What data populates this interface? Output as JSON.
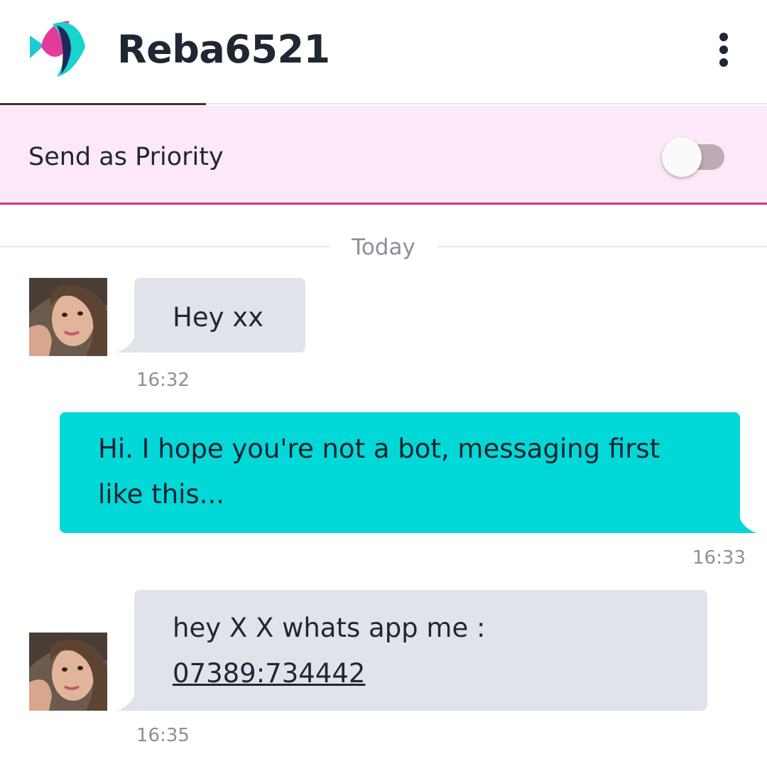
{
  "header": {
    "logo_icon": "fish-logo-icon",
    "contact_name": "Reba6521",
    "menu_icon": "more-vertical-icon"
  },
  "priority": {
    "label": "Send as Priority",
    "enabled": false
  },
  "date_divider": "Today",
  "messages": [
    {
      "direction": "incoming",
      "text": "Hey xx",
      "time": "16:32"
    },
    {
      "direction": "outgoing",
      "text_line1": "Hi. I hope you're not a bot, messaging first",
      "text_line2": "like this...",
      "time": "16:33"
    },
    {
      "direction": "incoming",
      "text_line1": "hey X X whats app me :",
      "phone": "07389:734442",
      "time": "16:35"
    }
  ],
  "colors": {
    "outgoing_bubble": "#02d8d8",
    "incoming_bubble": "#e0e3ea",
    "priority_bg": "#fce8f6",
    "priority_border": "#d0348f"
  }
}
